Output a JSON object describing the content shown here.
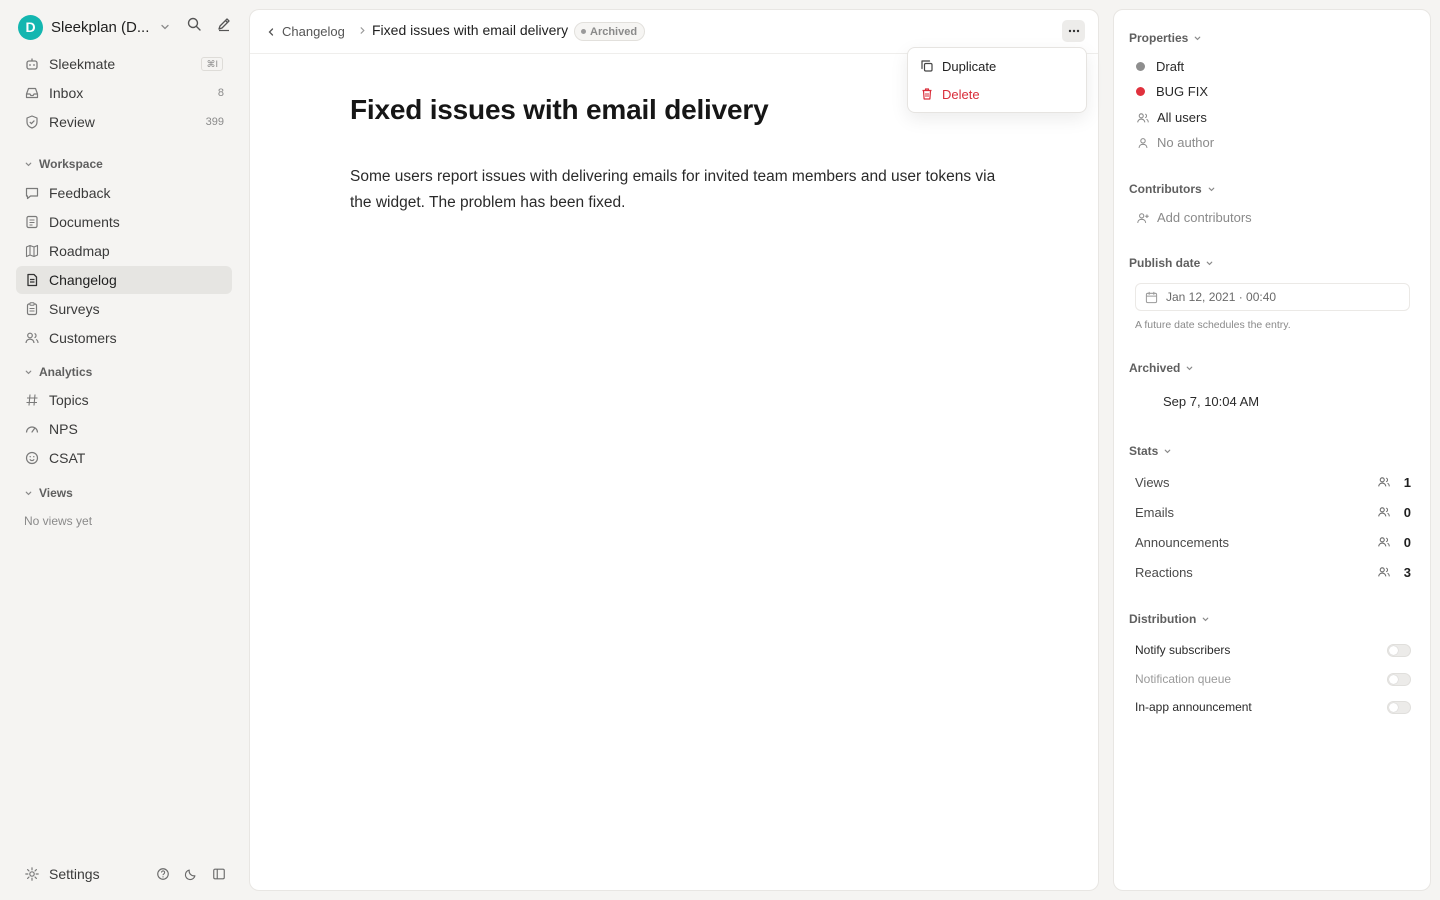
{
  "workspace": {
    "initial": "D",
    "name": "Sleekplan (D..."
  },
  "nav": {
    "top": [
      {
        "label": "Sleekmate",
        "kbd": "⌘I"
      },
      {
        "label": "Inbox",
        "count": "8"
      },
      {
        "label": "Review",
        "count": "399"
      }
    ],
    "workspace_label": "Workspace",
    "workspace_items": [
      "Feedback",
      "Documents",
      "Roadmap",
      "Changelog",
      "Surveys",
      "Customers"
    ],
    "analytics_label": "Analytics",
    "analytics_items": [
      "Topics",
      "NPS",
      "CSAT"
    ],
    "views_label": "Views",
    "views_empty": "No views yet",
    "settings_label": "Settings",
    "active_item": "Changelog"
  },
  "breadcrumb": {
    "back_label": "Changelog",
    "title": "Fixed issues with email delivery",
    "status_badge": "Archived"
  },
  "document": {
    "title": "Fixed issues with email delivery",
    "body": "Some users report issues with delivering emails for invited team members and user tokens via the widget. The problem has been fixed."
  },
  "menu": {
    "duplicate": "Duplicate",
    "delete": "Delete",
    "delete_color": "#d92d3a"
  },
  "properties": {
    "label": "Properties",
    "status": {
      "label": "Draft",
      "color": "#8e8e8e"
    },
    "category": {
      "label": "BUG FIX",
      "color": "#e0313d"
    },
    "audience": "All users",
    "author": "No author"
  },
  "contributors": {
    "label": "Contributors",
    "add_label": "Add contributors"
  },
  "publish_date": {
    "label": "Publish date",
    "value": "Jan 12, 2021 · 00:40",
    "hint": "A future date schedules the entry."
  },
  "archived": {
    "label": "Archived",
    "value": "Sep 7, 10:04 AM"
  },
  "stats": {
    "label": "Stats",
    "items": [
      {
        "label": "Views",
        "value": "1"
      },
      {
        "label": "Emails",
        "value": "0"
      },
      {
        "label": "Announcements",
        "value": "0"
      },
      {
        "label": "Reactions",
        "value": "3"
      }
    ]
  },
  "distribution": {
    "label": "Distribution",
    "items": [
      {
        "label": "Notify subscribers",
        "enabled": false
      },
      {
        "label": "Notification queue",
        "enabled": false
      },
      {
        "label": "In-app announcement",
        "enabled": false
      }
    ]
  }
}
